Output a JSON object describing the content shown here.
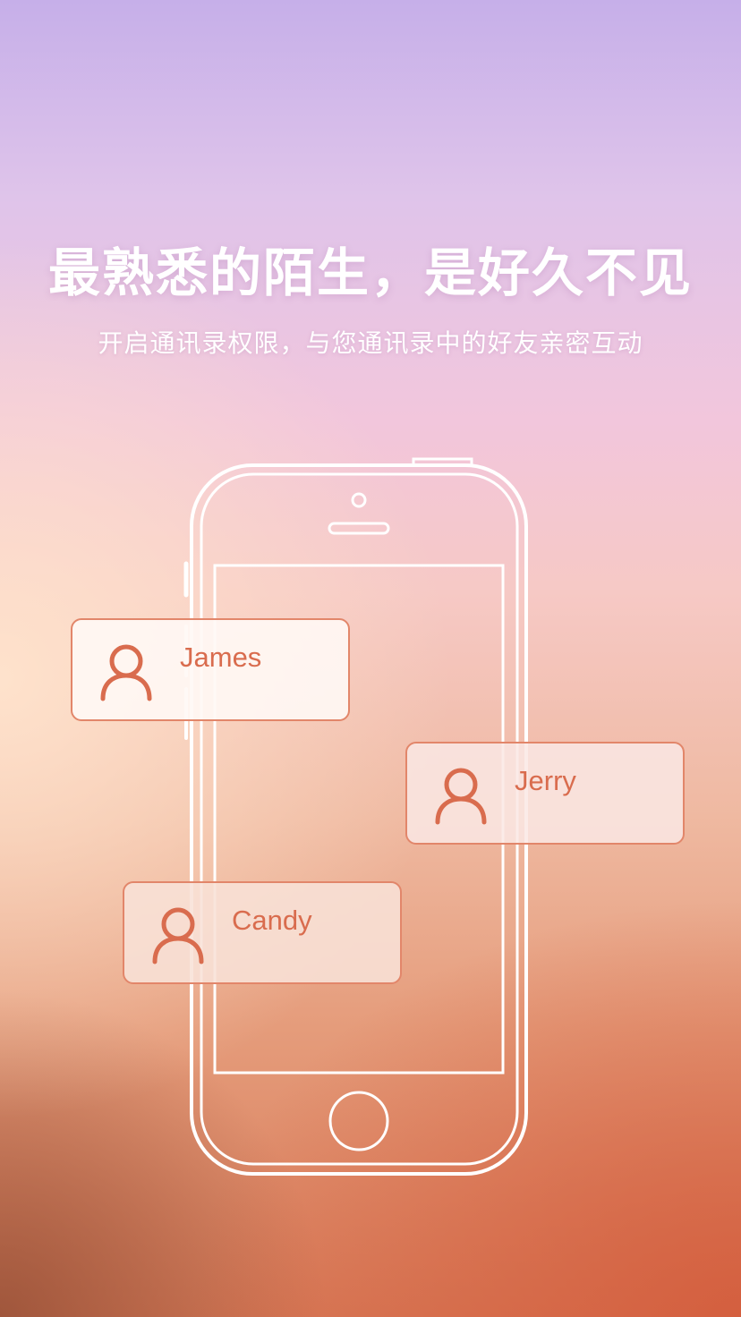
{
  "headline": "最熟悉的陌生，是好久不见",
  "subline": "开启通讯录权限，与您通讯录中的好友亲密互动",
  "illustration": {
    "device_icon": "smartphone-outline-icon"
  },
  "contacts": [
    {
      "name": "James",
      "icon": "person-icon"
    },
    {
      "name": "Jerry",
      "icon": "person-icon"
    },
    {
      "name": "Candy",
      "icon": "person-icon"
    }
  ],
  "colors": {
    "accent": "#d96c4e",
    "card_border": "#e2866a",
    "text": "#ffffff"
  }
}
